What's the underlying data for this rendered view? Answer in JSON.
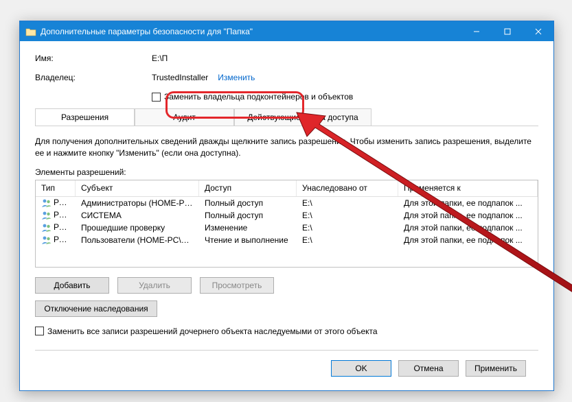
{
  "window": {
    "title": "Дополнительные параметры безопасности для \"Папка\""
  },
  "info": {
    "name_label": "Имя:",
    "name_value": "E:\\П",
    "owner_label": "Владелец:",
    "owner_value": "TrustedInstaller",
    "change_link": "Изменить",
    "replace_owner_cb": "Заменить владельца подконтейнеров и объектов"
  },
  "tabs": {
    "permissions": "Разрешения",
    "audit": "Аудит",
    "effective": "Действующие права доступа"
  },
  "desc": "Для получения дополнительных сведений дважды щелкните запись разрешения. Чтобы изменить запись разрешения, выделите ее и нажмите кнопку \"Изменить\" (если она доступна).",
  "perm_label": "Элементы разрешений:",
  "columns": {
    "type": "Тип",
    "subject": "Субъект",
    "access": "Доступ",
    "inherited": "Унаследовано от",
    "applies": "Применяется к"
  },
  "rows": [
    {
      "type": "Разр...",
      "subject": "Администраторы (HOME-PC...",
      "access": "Полный доступ",
      "inh": "E:\\",
      "apply": "Для этой папки, ее подпапок ..."
    },
    {
      "type": "Разр...",
      "subject": "СИСТЕМА",
      "access": "Полный доступ",
      "inh": "E:\\",
      "apply": "Для этой папки, ее подпапок ..."
    },
    {
      "type": "Разр...",
      "subject": "Прошедшие проверку",
      "access": "Изменение",
      "inh": "E:\\",
      "apply": "Для этой папки, ее подпапок ..."
    },
    {
      "type": "Разр...",
      "subject": "Пользователи (HOME-PC\\П...",
      "access": "Чтение и выполнение",
      "inh": "E:\\",
      "apply": "Для этой папки, ее подпапок ..."
    }
  ],
  "buttons": {
    "add": "Добавить",
    "remove": "Удалить",
    "view": "Просмотреть",
    "disable_inh": "Отключение наследования",
    "replace_child_cb": "Заменить все записи разрешений дочернего объекта наследуемыми от этого объекта",
    "ok": "OK",
    "cancel": "Отмена",
    "apply": "Применить"
  }
}
